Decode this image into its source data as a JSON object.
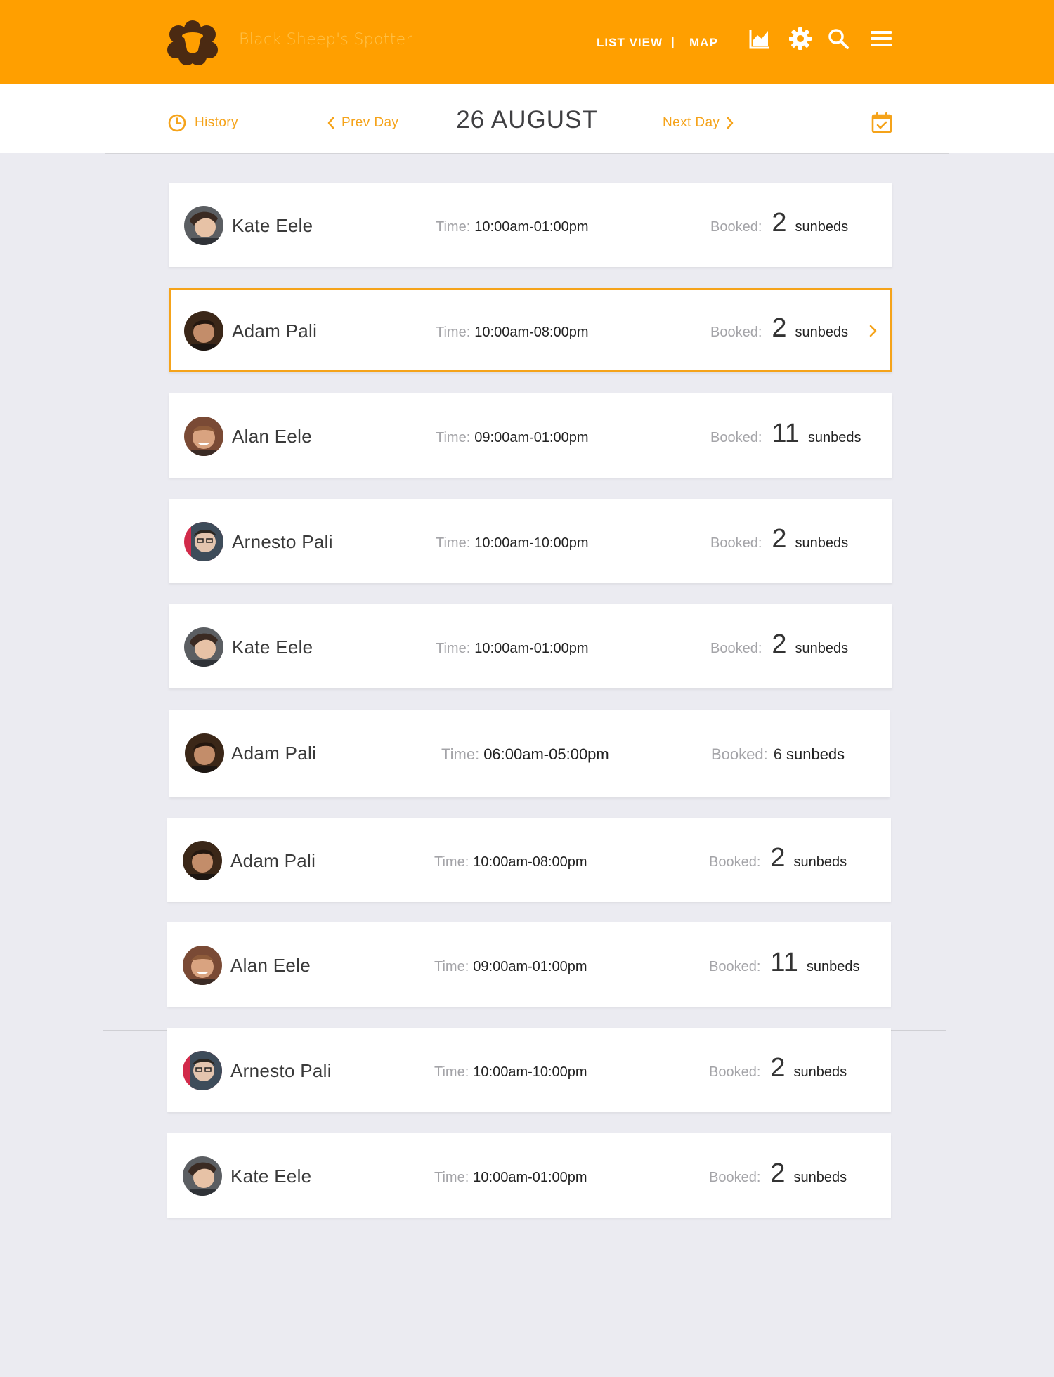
{
  "app": {
    "brand_name": "Black Sheep's Spotter",
    "accent_color": "#FF9F00",
    "nav": {
      "list_view": "LIST VIEW",
      "separator": "|",
      "map": "MAP"
    },
    "icons": [
      "chart-icon",
      "gear-icon",
      "search-icon",
      "menu-icon"
    ]
  },
  "datebar": {
    "history_label": "History",
    "prev_label": "Prev Day",
    "date": "26 AUGUST",
    "next_label": "Next Day"
  },
  "labels": {
    "time": "Time:",
    "booked": "Booked:",
    "unit": "sunbeds"
  },
  "bookings": [
    {
      "name": "Kate Eele",
      "time": "10:00am-01:00pm",
      "count": "2"
    },
    {
      "name": "Adam Pali",
      "time": "10:00am-08:00pm",
      "count": "2"
    },
    {
      "name": "Alan Eele",
      "time": "09:00am-01:00pm",
      "count": "11"
    },
    {
      "name": "Arnesto Pali",
      "time": "10:00am-10:00pm",
      "count": "2"
    },
    {
      "name": "Kate Eele",
      "time": "10:00am-01:00pm",
      "count": "2"
    },
    {
      "name": "Adam Pali",
      "time": "06:00am-05:00pm",
      "count": "6"
    },
    {
      "name": "Adam Pali",
      "time": "10:00am-08:00pm",
      "count": "2"
    },
    {
      "name": "Alan Eele",
      "time": "09:00am-01:00pm",
      "count": "11"
    },
    {
      "name": "Arnesto Pali",
      "time": "10:00am-10:00pm",
      "count": "2"
    },
    {
      "name": "Kate Eele",
      "time": "10:00am-01:00pm",
      "count": "2"
    }
  ]
}
